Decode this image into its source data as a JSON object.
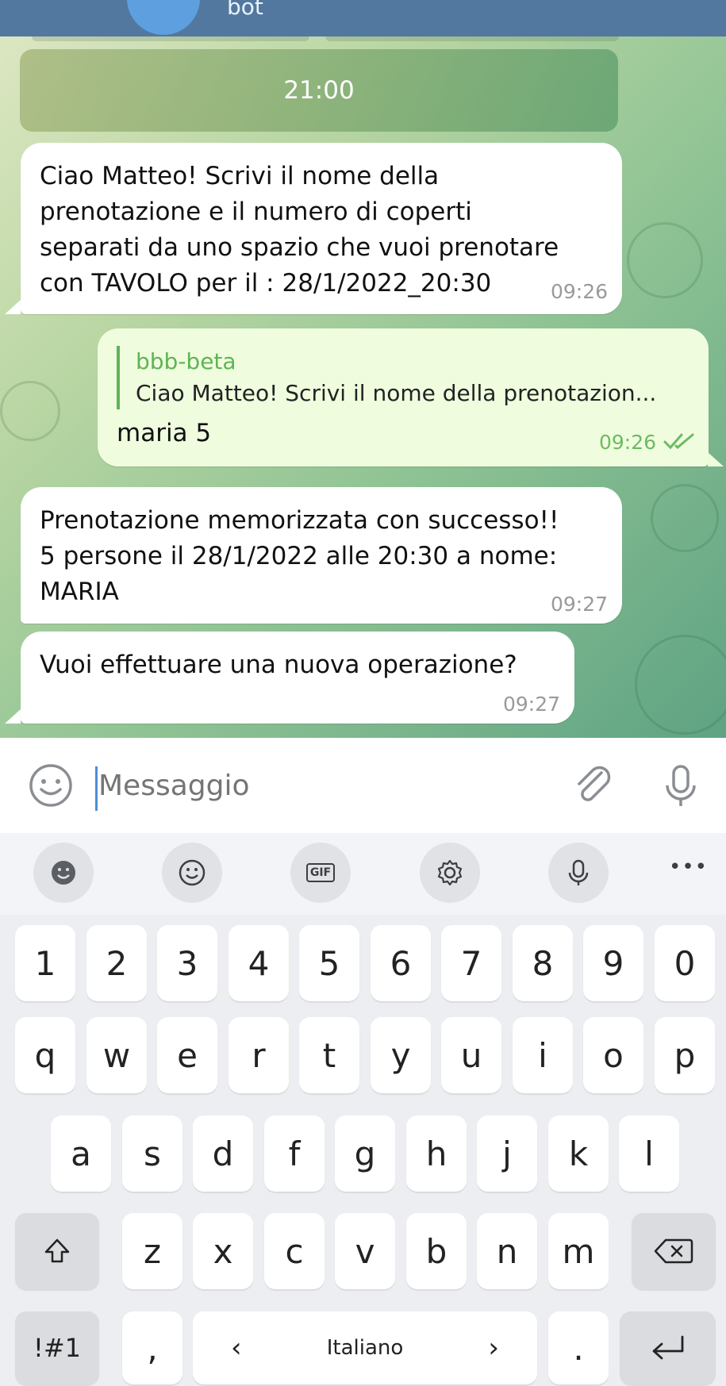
{
  "header": {
    "subtitle": "bot"
  },
  "date_chip": "21:00",
  "messages": {
    "m1": {
      "text": "Ciao Matteo! Scrivi il nome della\nprenotazione e il numero di coperti\nseparati da uno spazio che vuoi prenotare\ncon TAVOLO per il : 28/1/2022_20:30",
      "time": "09:26"
    },
    "m2": {
      "reply_name": "bbb-beta",
      "reply_text": "Ciao Matteo! Scrivi il nome della prenotazion...",
      "text": "maria 5",
      "time": "09:26"
    },
    "m3": {
      "text": "Prenotazione memorizzata con successo!!\n5 persone il 28/1/2022 alle 20:30 a nome:\nMARIA",
      "time": "09:27"
    },
    "m4": {
      "text": "Vuoi effettuare una nuova operazione?",
      "time": "09:27"
    }
  },
  "input": {
    "placeholder": "Messaggio"
  },
  "suggest": {
    "gif": "GIF",
    "more": "•••"
  },
  "keyboard": {
    "row_numbers": [
      "1",
      "2",
      "3",
      "4",
      "5",
      "6",
      "7",
      "8",
      "9",
      "0"
    ],
    "row1": [
      "q",
      "w",
      "e",
      "r",
      "t",
      "y",
      "u",
      "i",
      "o",
      "p"
    ],
    "row2": [
      "a",
      "s",
      "d",
      "f",
      "g",
      "h",
      "j",
      "k",
      "l"
    ],
    "row3": [
      "z",
      "x",
      "c",
      "v",
      "b",
      "n",
      "m"
    ],
    "symbols": "!#1",
    "comma": ",",
    "lang_left": "‹",
    "language": "Italiano",
    "lang_right": "›",
    "period": "."
  },
  "icons": [
    "emoji-icon",
    "attach-icon",
    "mic-icon",
    "sticker-icon",
    "smiley-icon",
    "gif-icon",
    "settings-icon",
    "voice-icon",
    "more-icon",
    "shift-icon",
    "backspace-icon",
    "enter-icon",
    "double-check-icon"
  ],
  "colors": {
    "header": "#52789f",
    "outgoing_bubble": "#effdde",
    "outgoing_time": "#6dbb63",
    "accent": "#5fb456"
  }
}
